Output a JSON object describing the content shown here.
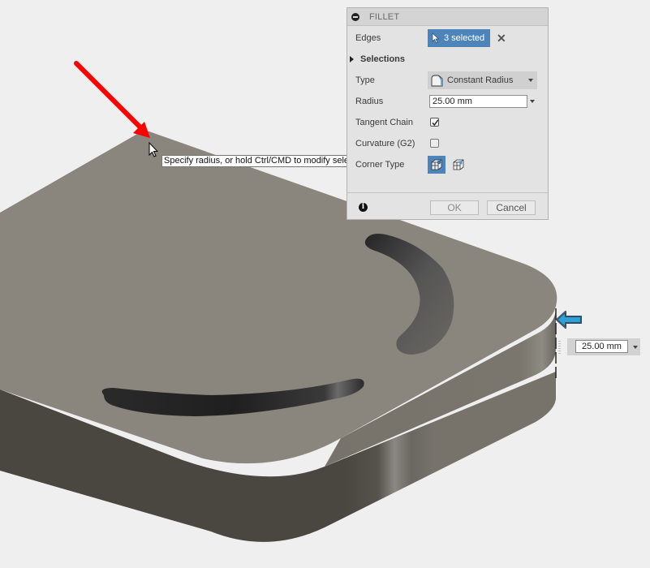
{
  "dialog": {
    "title": "FILLET",
    "edges_label": "Edges",
    "edges_value": "3 selected",
    "selections_label": "Selections",
    "type_label": "Type",
    "type_value": "Constant Radius",
    "radius_label": "Radius",
    "radius_value": "25.00 mm",
    "tangent_chain_label": "Tangent Chain",
    "tangent_chain_checked": true,
    "curvature_label": "Curvature (G2)",
    "curvature_checked": false,
    "corner_type_label": "Corner Type",
    "ok_label": "OK",
    "cancel_label": "Cancel"
  },
  "tooltip": {
    "text": "Specify radius, or hold Ctrl/CMD to modify selections"
  },
  "dimension": {
    "value": "25.00 mm"
  },
  "colors": {
    "accent": "#4d85bb",
    "annotation_arrow": "#ff0000",
    "manipulator_arrow": "#2ea0d8",
    "part_top": "#8a857d",
    "part_side_dark": "#4a4741",
    "part_side_light": "#77736b",
    "background": "#efefef"
  }
}
